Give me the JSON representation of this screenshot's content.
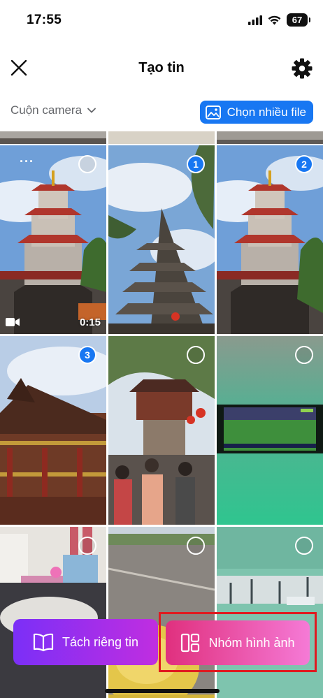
{
  "status_bar": {
    "time": "17:55",
    "battery": "67",
    "icons": [
      "signal-icon",
      "wifi-icon",
      "battery-icon"
    ]
  },
  "header": {
    "title": "Tạo tin",
    "close_icon": "close-icon",
    "settings_icon": "gear-icon"
  },
  "source": {
    "album_label": "Cuộn camera",
    "multi_select_label": "Chọn nhiều file"
  },
  "grid": {
    "tiles": [
      {
        "id": "pagoda-tower-video",
        "selected": false,
        "video": true,
        "duration": "0:15"
      },
      {
        "id": "pagoda-stupa",
        "selected": true,
        "order": "1"
      },
      {
        "id": "pagoda-tower-2",
        "selected": true,
        "order": "2"
      },
      {
        "id": "temple-hall",
        "selected": true,
        "order": "3"
      },
      {
        "id": "pavilion-crowd",
        "selected": false
      },
      {
        "id": "football-screen",
        "selected": false
      },
      {
        "id": "bedroom-items",
        "selected": false
      },
      {
        "id": "roadside-helmet",
        "selected": false
      },
      {
        "id": "ceiling-pipes",
        "selected": false
      }
    ]
  },
  "actions": {
    "separate_label": "Tách riêng tin",
    "group_label": "Nhóm hình ảnh"
  },
  "colors": {
    "accent": "#1877f2",
    "highlight": "#e0191f"
  }
}
